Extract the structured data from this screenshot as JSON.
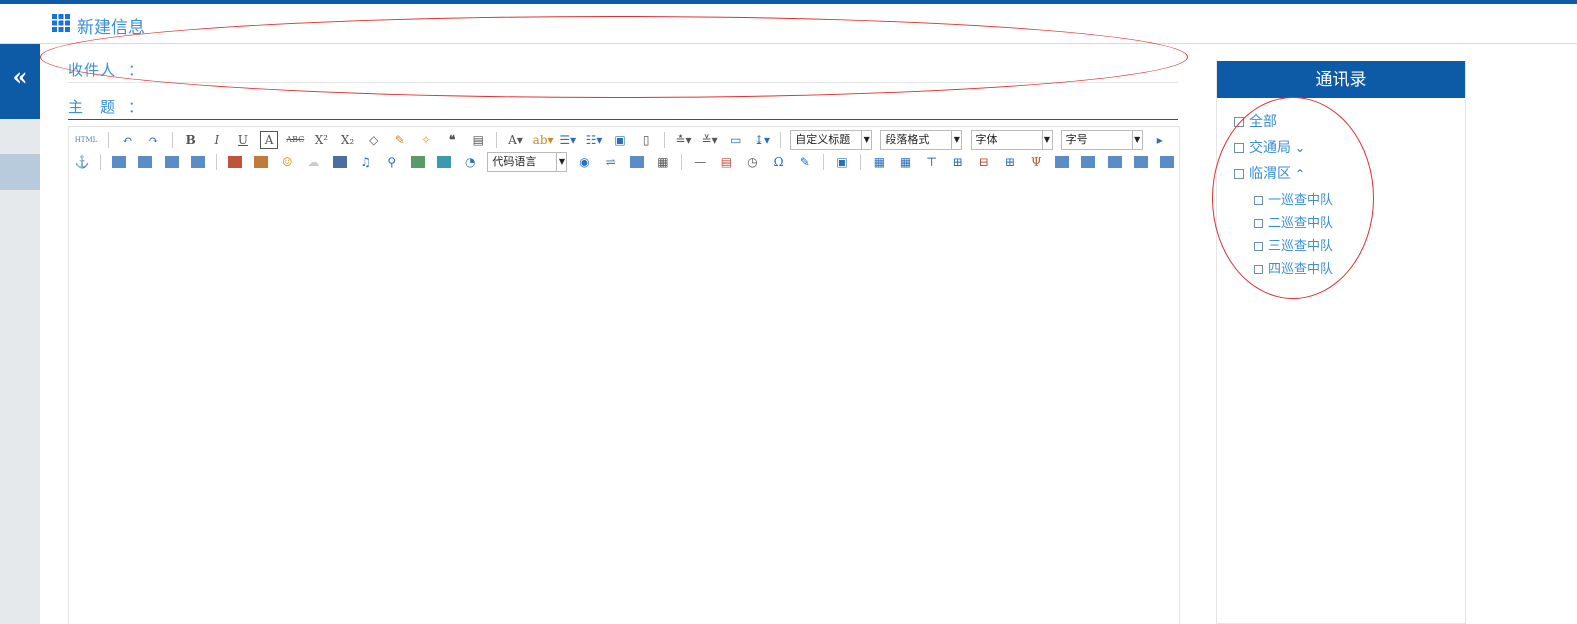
{
  "header": {
    "title": "新建信息"
  },
  "form": {
    "recipient_label": "收件人",
    "subject_label": "主　题",
    "colon": "："
  },
  "editor": {
    "toolbar": {
      "row1": [
        "html-icon",
        "undo-icon",
        "redo-icon",
        "bold-icon",
        "italic-icon",
        "underline-icon",
        "fontborder-icon",
        "strikethrough-icon",
        "superscript-icon",
        "subscript-icon",
        "eraser-icon",
        "formatmatch-icon",
        "autotypeset-icon",
        "blockquote-icon",
        "pasteplain-icon",
        "forecolor-icon",
        "backcolor-icon",
        "ordered-list-icon",
        "unordered-list-icon",
        "selectall-icon",
        "cleardoc-icon",
        "rowspacing-top-icon",
        "rowspacing-bottom-icon",
        "preview-icon",
        "lineheight-icon"
      ],
      "customstyle": "自定义标题",
      "paragraph": "段落格式",
      "fontfamily": "字体",
      "fontsize": "字号",
      "codelang": "代码语言"
    }
  },
  "contacts": {
    "title": "通讯录",
    "tree": {
      "all": "全部",
      "groups": [
        {
          "label": "交通局",
          "expanded": false,
          "chevron": "chevron-down-icon"
        },
        {
          "label": "临渭区",
          "expanded": true,
          "chevron": "chevron-up-icon",
          "children": [
            "一巡查中队",
            "二巡查中队",
            "三巡查中队",
            "四巡查中队"
          ]
        }
      ]
    }
  },
  "colors": {
    "primary": "#0d5aa7",
    "link": "#3a8fd6",
    "annotation": "#e03030"
  }
}
